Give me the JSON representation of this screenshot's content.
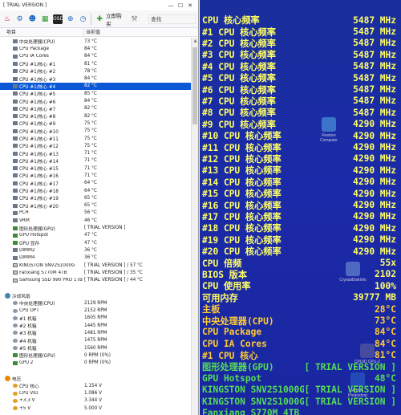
{
  "window": {
    "title": "[ TRIAL VERSION ]",
    "controls": {
      "minimize": "—",
      "maximize": "☐",
      "close": "✕"
    }
  },
  "toolbar": {
    "report_label": "立即购买",
    "search_placeholder": "查找"
  },
  "columns": {
    "item": "项目",
    "value": "当前值"
  },
  "tree": [
    {
      "name": "中央处理器(CPU)",
      "value": "73 °C",
      "icon": "chip"
    },
    {
      "name": "CPU Package",
      "value": "84 °C",
      "icon": "chip"
    },
    {
      "name": "CPU IA Cores",
      "value": "84 °C",
      "icon": "chip"
    },
    {
      "name": "CPU #1/核心 #1",
      "value": "81 °C",
      "icon": "chip"
    },
    {
      "name": "CPU #1/核心 #2",
      "value": "78 °C",
      "icon": "chip"
    },
    {
      "name": "CPU #1/核心 #3",
      "value": "84 °C",
      "icon": "chip"
    },
    {
      "name": "CPU #1/核心 #4",
      "value": "82 °C",
      "icon": "chip",
      "selected": true
    },
    {
      "name": "CPU #1/核心 #5",
      "value": "85 °C",
      "icon": "chip"
    },
    {
      "name": "CPU #1/核心 #6",
      "value": "84 °C",
      "icon": "chip"
    },
    {
      "name": "CPU #1/核心 #7",
      "value": "82 °C",
      "icon": "chip"
    },
    {
      "name": "CPU #1/核心 #8",
      "value": "82 °C",
      "icon": "chip"
    },
    {
      "name": "CPU #1/核心 #9",
      "value": "75 °C",
      "icon": "chip"
    },
    {
      "name": "CPU #1/核心 #10",
      "value": "75 °C",
      "icon": "chip"
    },
    {
      "name": "CPU #1/核心 #11",
      "value": "75 °C",
      "icon": "chip"
    },
    {
      "name": "CPU #1/核心 #12",
      "value": "75 °C",
      "icon": "chip"
    },
    {
      "name": "CPU #1/核心 #13",
      "value": "71 °C",
      "icon": "chip"
    },
    {
      "name": "CPU #1/核心 #14",
      "value": "71 °C",
      "icon": "chip"
    },
    {
      "name": "CPU #1/核心 #15",
      "value": "71 °C",
      "icon": "chip"
    },
    {
      "name": "CPU #1/核心 #16",
      "value": "71 °C",
      "icon": "chip"
    },
    {
      "name": "CPU #1/核心 #17",
      "value": "64 °C",
      "icon": "chip"
    },
    {
      "name": "CPU #1/核心 #18",
      "value": "64 °C",
      "icon": "chip"
    },
    {
      "name": "CPU #1/核心 #19",
      "value": "65 °C",
      "icon": "chip"
    },
    {
      "name": "CPU #1/核心 #20",
      "value": "65 °C",
      "icon": "chip"
    },
    {
      "name": "PCH",
      "value": "56 °C",
      "icon": "chip"
    },
    {
      "name": "VRM",
      "value": "46 °C",
      "icon": "chip"
    },
    {
      "name": "图形处理器(GPU)",
      "value": "[ TRIAL VERSION ]",
      "icon": "gpu"
    },
    {
      "name": "GPU Hotspot",
      "value": "47 °C",
      "icon": "gpu"
    },
    {
      "name": "GPU 显存",
      "value": "47 °C",
      "icon": "gpu"
    },
    {
      "name": "DIMM2",
      "value": "36 °C",
      "icon": "chip"
    },
    {
      "name": "DIMM4",
      "value": "36 °C",
      "icon": "chip"
    },
    {
      "name": "KINGSTON SNV2S1000G",
      "value": "[ TRIAL VERSION ] / 57 °C",
      "icon": "disk"
    },
    {
      "name": "Fanxiang S770M 4TB",
      "value": "[ TRIAL VERSION ] / 35 °C",
      "icon": "disk"
    },
    {
      "name": "Samsung SSD 990 PRO 1TB",
      "value": "[ TRIAL VERSION ] / 44 °C",
      "icon": "disk"
    },
    {
      "name": "",
      "value": "",
      "icon": "none",
      "spacer": true
    },
    {
      "name": "冷却风扇",
      "value": "",
      "icon": "sect-fan",
      "section": true
    },
    {
      "name": "中央处理器(CPU)",
      "value": "2129 RPM",
      "icon": "fan"
    },
    {
      "name": "CPU OPT",
      "value": "2152 RPM",
      "icon": "fan"
    },
    {
      "name": "#1 机箱",
      "value": "1605 RPM",
      "icon": "fan"
    },
    {
      "name": "#2 机箱",
      "value": "1445 RPM",
      "icon": "fan"
    },
    {
      "name": "#3 机箱",
      "value": "1481 RPM",
      "icon": "fan"
    },
    {
      "name": "#4 机箱",
      "value": "1475 RPM",
      "icon": "fan"
    },
    {
      "name": "#5 机箱",
      "value": "1560 RPM",
      "icon": "fan"
    },
    {
      "name": "图形处理器(GPU)",
      "value": "0 RPM  (0%)",
      "icon": "gpu"
    },
    {
      "name": "GPU 2",
      "value": "0 RPM  (0%)",
      "icon": "gpu"
    },
    {
      "name": "",
      "value": "",
      "icon": "none",
      "spacer": true
    },
    {
      "name": "电压",
      "value": "",
      "icon": "sect-volt",
      "section": true
    },
    {
      "name": "CPU 核心",
      "value": "1.154 V",
      "icon": "volt"
    },
    {
      "name": "CPU VID",
      "value": "1.086 V",
      "icon": "volt"
    },
    {
      "name": "+3.3 V",
      "value": "3.344 V",
      "icon": "volt"
    },
    {
      "name": "+5 V",
      "value": "5.000 V",
      "icon": "volt"
    }
  ],
  "osd": [
    {
      "label": "CPU 核心频率",
      "value": "5487 MHz",
      "lc": "#ffff66",
      "vc": "#ffff66"
    },
    {
      "label": "#1 CPU 核心频率",
      "value": "5487 MHz",
      "lc": "#ffff66",
      "vc": "#ffff66"
    },
    {
      "label": "#2 CPU 核心频率",
      "value": "5487 MHz",
      "lc": "#ffff66",
      "vc": "#ffff66"
    },
    {
      "label": "#3 CPU 核心频率",
      "value": "5487 MHz",
      "lc": "#ffff66",
      "vc": "#ffff66"
    },
    {
      "label": "#4 CPU 核心频率",
      "value": "5487 MHz",
      "lc": "#ffff66",
      "vc": "#ffff66"
    },
    {
      "label": "#5 CPU 核心频率",
      "value": "5487 MHz",
      "lc": "#ffff66",
      "vc": "#ffff66"
    },
    {
      "label": "#6 CPU 核心频率",
      "value": "5487 MHz",
      "lc": "#ffff66",
      "vc": "#ffff66"
    },
    {
      "label": "#7 CPU 核心频率",
      "value": "5487 MHz",
      "lc": "#ffff66",
      "vc": "#ffff66"
    },
    {
      "label": "#8 CPU 核心频率",
      "value": "5487 MHz",
      "lc": "#ffff66",
      "vc": "#ffff66"
    },
    {
      "label": "#9 CPU 核心频率",
      "value": "4290 MHz",
      "lc": "#ffff66",
      "vc": "#ffff66"
    },
    {
      "label": "#10 CPU 核心频率",
      "value": "4290 MHz",
      "lc": "#ffff66",
      "vc": "#ffff66"
    },
    {
      "label": "#11 CPU 核心频率",
      "value": "4290 MHz",
      "lc": "#ffff66",
      "vc": "#ffff66"
    },
    {
      "label": "#12 CPU 核心频率",
      "value": "4290 MHz",
      "lc": "#ffff66",
      "vc": "#ffff66"
    },
    {
      "label": "#13 CPU 核心频率",
      "value": "4290 MHz",
      "lc": "#ffff66",
      "vc": "#ffff66"
    },
    {
      "label": "#14 CPU 核心频率",
      "value": "4290 MHz",
      "lc": "#ffff66",
      "vc": "#ffff66"
    },
    {
      "label": "#15 CPU 核心频率",
      "value": "4290 MHz",
      "lc": "#ffff66",
      "vc": "#ffff66"
    },
    {
      "label": "#16 CPU 核心频率",
      "value": "4290 MHz",
      "lc": "#ffff66",
      "vc": "#ffff66"
    },
    {
      "label": "#17 CPU 核心频率",
      "value": "4290 MHz",
      "lc": "#ffff66",
      "vc": "#ffff66"
    },
    {
      "label": "#18 CPU 核心频率",
      "value": "4290 MHz",
      "lc": "#ffff66",
      "vc": "#ffff66"
    },
    {
      "label": "#19 CPU 核心频率",
      "value": "4290 MHz",
      "lc": "#ffff66",
      "vc": "#ffff66"
    },
    {
      "label": "#20 CPU 核心频率",
      "value": "4290 MHz",
      "lc": "#ffff66",
      "vc": "#ffff66"
    },
    {
      "label": "CPU 倍频",
      "value": "55x",
      "lc": "#ffff66",
      "vc": "#ffff66"
    },
    {
      "label": "BIOS 版本",
      "value": "2102",
      "lc": "#ffff66",
      "vc": "#ffff66"
    },
    {
      "label": "CPU 使用率",
      "value": "100%",
      "lc": "#ffff66",
      "vc": "#ffff66"
    },
    {
      "label": "可用内存",
      "value": "39777 MB",
      "lc": "#ffff66",
      "vc": "#ffff66"
    },
    {
      "label": "主板",
      "value": "28°C",
      "lc": "#ffcc33",
      "vc": "#ffcc33"
    },
    {
      "label": "中央处理器(CPU)",
      "value": "73°C",
      "lc": "#ffcc33",
      "vc": "#ffcc33"
    },
    {
      "label": "CPU Package",
      "value": "84°C",
      "lc": "#ffcc33",
      "vc": "#ffcc33"
    },
    {
      "label": "CPU IA Cores",
      "value": "84°C",
      "lc": "#ffcc33",
      "vc": "#ffcc33"
    },
    {
      "label": " #1 CPU 核心",
      "value": "81°C",
      "lc": "#ffcc33",
      "vc": "#ffcc33"
    },
    {
      "label": "图形处理器(GPU)",
      "value": "[ TRIAL VERSION ]",
      "lc": "#55dd55",
      "vc": "#55dd55"
    },
    {
      "label": "GPU Hotspot",
      "value": "48°C",
      "lc": "#55dd55",
      "vc": "#55dd55"
    },
    {
      "label": "KINGSTON SNV2S1000G",
      "value": "[ TRIAL VERSION ]",
      "lc": "#55dd55",
      "vc": "#55dd55"
    },
    {
      "label": "KINGSTON SNV2S1000G #2",
      "value": "[ TRIAL VERSION ]",
      "lc": "#55dd55",
      "vc": "#55dd55"
    },
    {
      "label": "Fanxiang S770M 4TB",
      "value": "",
      "lc": "#55dd55",
      "vc": "#55dd55"
    }
  ],
  "desktop_ghosts": [
    {
      "text": "Restore Computer",
      "icon_color": "#5ab0e8"
    },
    {
      "text": "CrystalDiskInfo",
      "icon_color": "#7aa0d8"
    },
    {
      "text": "CPUID CPU-Z",
      "icon_color": "#6a6a9a"
    },
    {
      "text": "Adobe Photoshop",
      "icon_color": "#2a6acc"
    }
  ],
  "colors": {
    "accent": "#0a58d6",
    "osd_bg": "#1b2aa8"
  }
}
